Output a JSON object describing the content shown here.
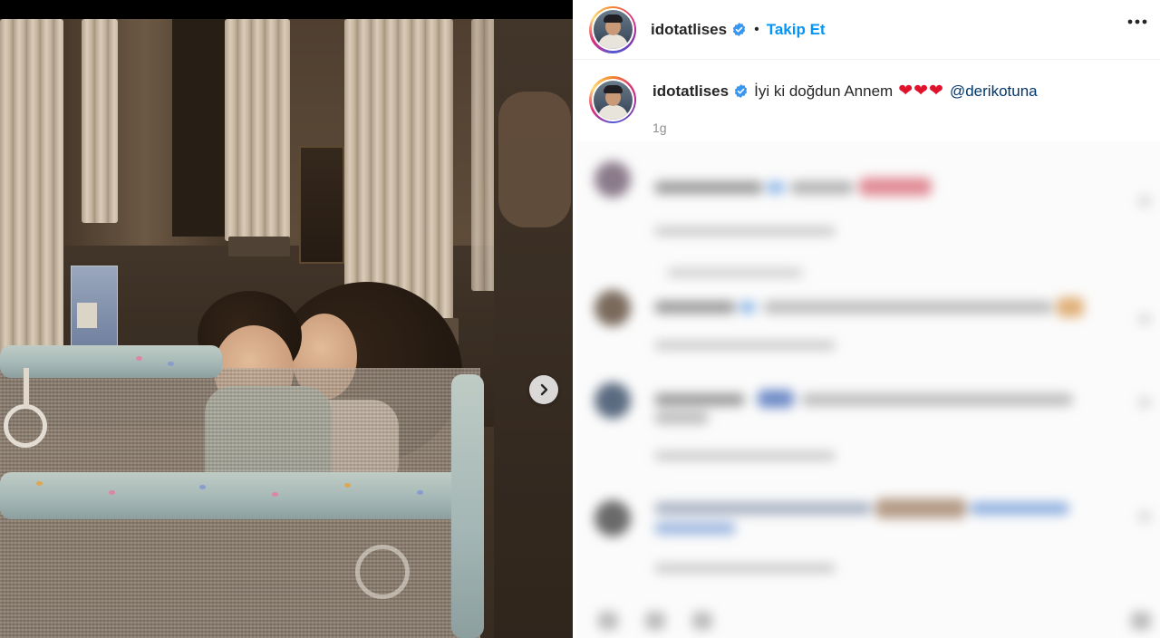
{
  "post": {
    "author": "idotatlises",
    "follow_label": "Takip Et",
    "separator": "•",
    "caption_text": "İyi ki doğdun Annem",
    "caption_hearts": "❤❤❤",
    "caption_mention": "@derikotuna",
    "timestamp": "1g"
  },
  "icons": {
    "verified": "verified-badge-icon",
    "more": "more-options-icon",
    "next": "chevron-right-icon"
  },
  "colors": {
    "link_blue": "#0095f6",
    "mention_blue": "#00376b",
    "verified_blue": "#3897f0",
    "heart_red": "#e0112b",
    "muted_text": "#8e8e8e"
  },
  "comments_blurred": true
}
